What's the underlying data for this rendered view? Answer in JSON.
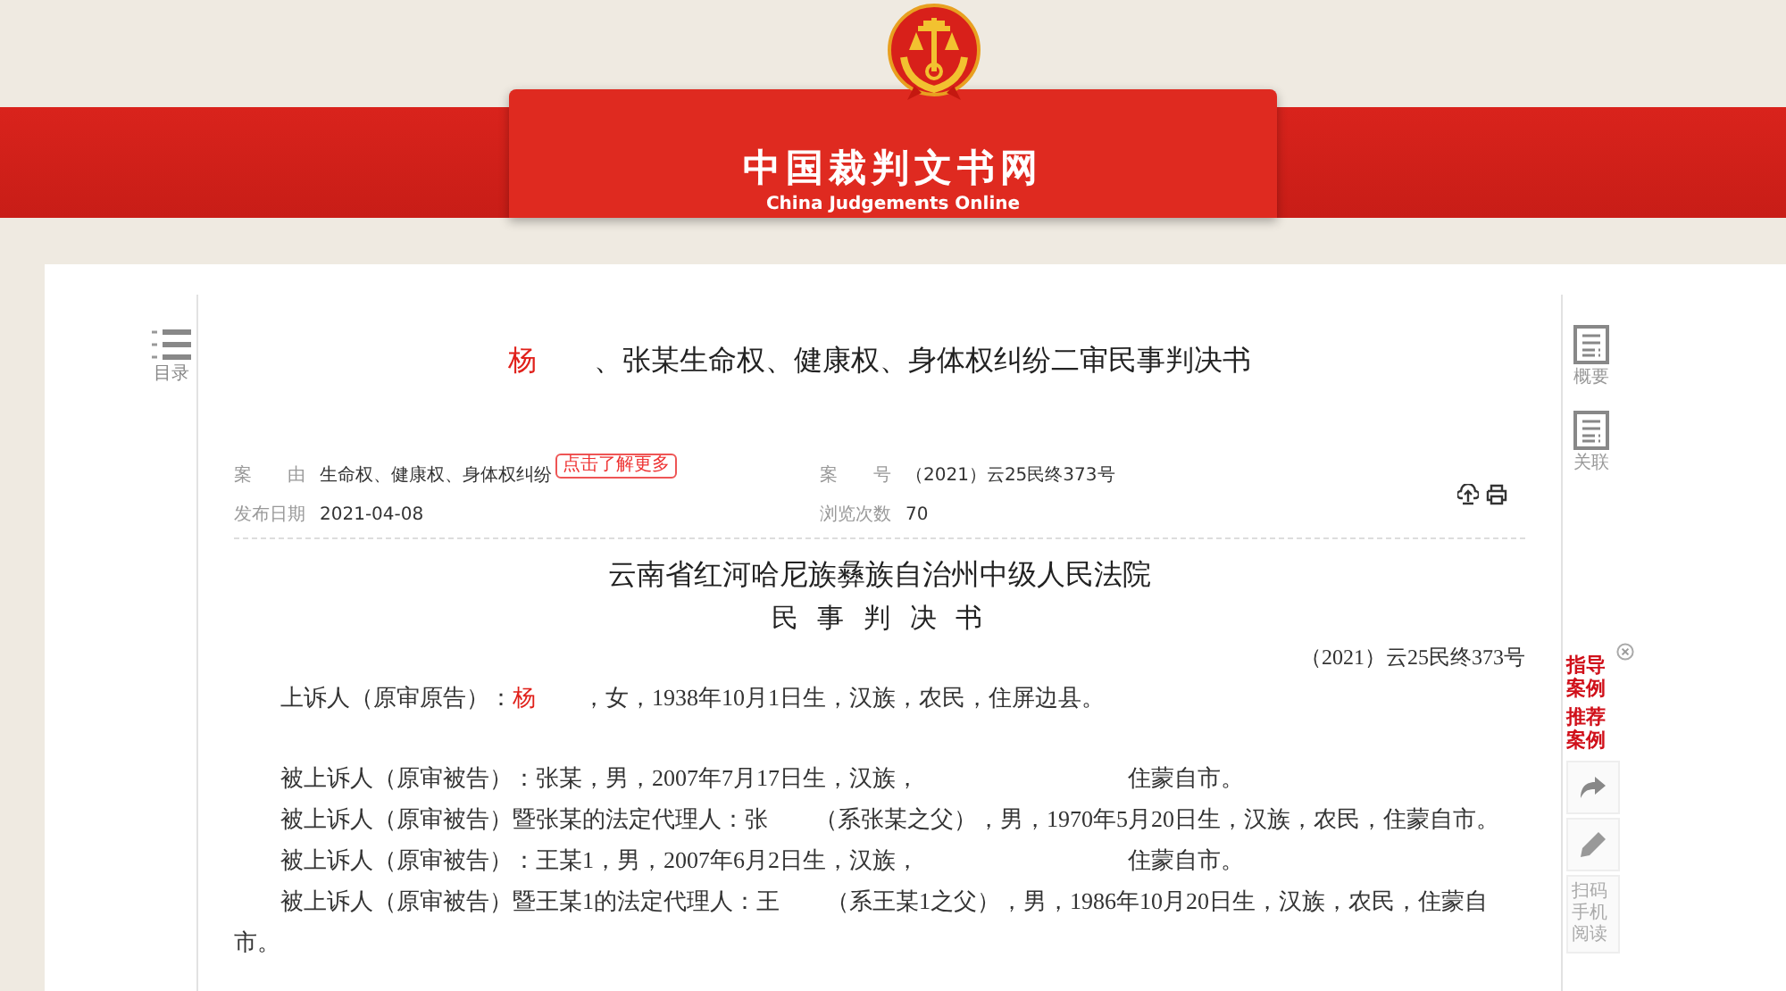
{
  "header": {
    "title": "中国裁判文书网",
    "subtitle": "China Judgements Online"
  },
  "toc": {
    "label": "目录"
  },
  "document": {
    "title_parts": [
      {
        "kind": "name",
        "text": "杨"
      },
      {
        "kind": "plain",
        "text": "　　、张某生命权、健康权、身体权纠纷二审民事判决书"
      }
    ],
    "meta": [
      {
        "label": "案　　由",
        "value": "生命权、健康权、身体权纠纷",
        "badge": "点击了解更多"
      },
      {
        "label": "案　　号",
        "value": "（2021）云25民终373号"
      },
      {
        "label": "发布日期",
        "value": "2021-04-08"
      },
      {
        "label": "浏览次数",
        "value": "70"
      }
    ],
    "court": "云南省红河哈尼族彝族自治州中级人民法院",
    "doc_type": "民 事 判 决 书",
    "case_number": "（2021）云25民终373号",
    "paragraphs": [
      {
        "parts": [
          {
            "kind": "plain",
            "text": "上诉人（原审原告）："
          },
          {
            "kind": "name",
            "text": "杨"
          },
          {
            "kind": "plain",
            "text": "　　，女，1938年10月1日生，汉族，农民，住屏边县。"
          }
        ]
      },
      {
        "parts": [
          {
            "kind": "plain",
            "text": "被上诉人（原审被告）：张某，男，2007年7月17日生，汉族，　　　　　　　　　住蒙自市。"
          }
        ]
      },
      {
        "parts": [
          {
            "kind": "plain",
            "text": "被上诉人（原审被告）暨张某的法定代理人：张　　（系张某之父），男，1970年5月20日生，汉族，农民，住蒙自市。"
          }
        ]
      },
      {
        "parts": [
          {
            "kind": "plain",
            "text": "被上诉人（原审被告）：王某1，男，2007年6月2日生，汉族，　　　　　　　　　住蒙自市。"
          }
        ]
      },
      {
        "parts": [
          {
            "kind": "plain",
            "text": "被上诉人（原审被告）暨王某1的法定代理人：王　　（系王某1之父），男，1986年10月20日生，汉族，农民，住蒙自市。"
          }
        ]
      }
    ]
  },
  "side_tools": [
    {
      "label": "概要"
    },
    {
      "label": "关联"
    }
  ],
  "recommend": {
    "links": [
      "指导案例",
      "推荐案例"
    ],
    "scan_label": "扫码手机阅读"
  }
}
